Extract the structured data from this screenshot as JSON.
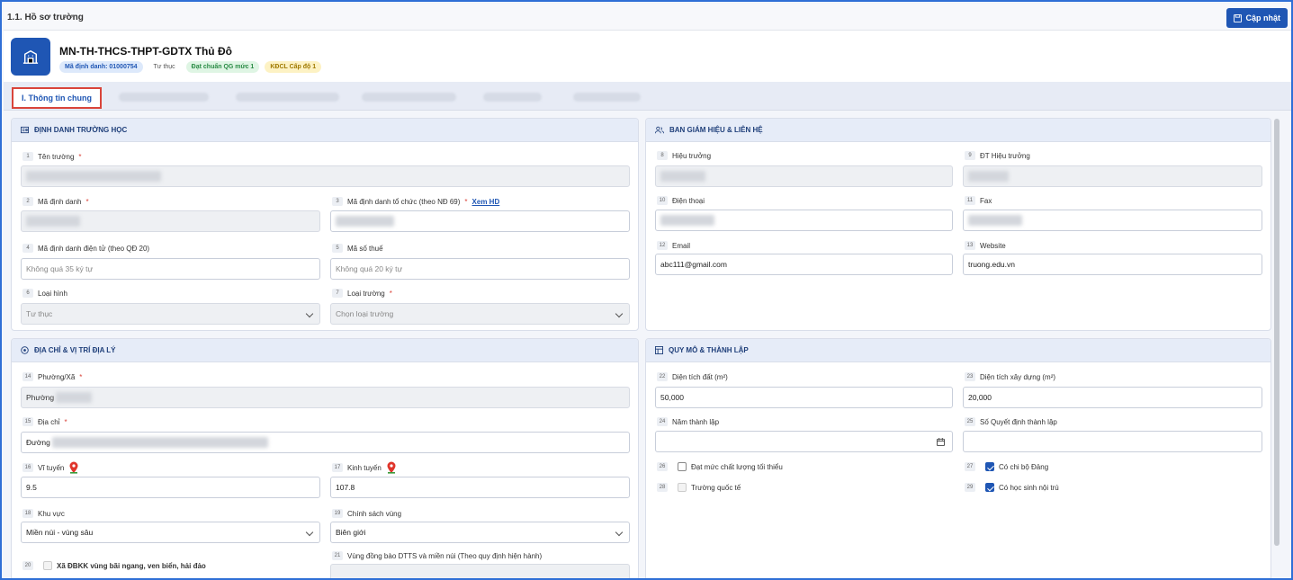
{
  "breadcrumb": "1.1. Hồ sơ trường",
  "update_button": "Cập nhật",
  "school": {
    "name": "MN-TH-THCS-THPT-GDTX Thủ Đô",
    "badges": [
      "Mã định danh: 01000754",
      "Tư thục",
      "Đạt chuẩn QG mức 1",
      "KĐCL Cấp độ 1"
    ]
  },
  "tabs": {
    "active": "I. Thông tin chung"
  },
  "identity": {
    "title": "ĐỊNH DANH TRƯỜNG HỌC",
    "f1": {
      "num": "1",
      "label": "Tên trường"
    },
    "f2": {
      "num": "2",
      "label": "Mã định danh"
    },
    "f3": {
      "num": "3",
      "label": "Mã định danh tổ chức (theo NĐ 69)",
      "link": "Xem HD"
    },
    "f4": {
      "num": "4",
      "label": "Mã định danh điện tử (theo QĐ 20)",
      "placeholder": "Không quá 35 ký tự"
    },
    "f5": {
      "num": "5",
      "label": "Mã số thuế",
      "placeholder": "Không quá 20 ký tự"
    },
    "f6": {
      "num": "6",
      "label": "Loại hình",
      "value": "Tư thục"
    },
    "f7": {
      "num": "7",
      "label": "Loại trường",
      "placeholder": "Chọn loại trường"
    }
  },
  "board": {
    "title": "BAN GIÁM HIỆU & LIÊN HỆ",
    "f8": {
      "num": "8",
      "label": "Hiệu trưởng"
    },
    "f9": {
      "num": "9",
      "label": "ĐT Hiệu trưởng"
    },
    "f10": {
      "num": "10",
      "label": "Điện thoại"
    },
    "f11": {
      "num": "11",
      "label": "Fax"
    },
    "f12": {
      "num": "12",
      "label": "Email",
      "value": "abc111@gmail.com"
    },
    "f13": {
      "num": "13",
      "label": "Website",
      "value": "truong.edu.vn"
    }
  },
  "address": {
    "title": "ĐỊA CHỈ & VỊ TRÍ ĐỊA LÝ",
    "f14": {
      "num": "14",
      "label": "Phường/Xã",
      "value": "Phường"
    },
    "f15": {
      "num": "15",
      "label": "Địa chỉ",
      "value": "Đường"
    },
    "f16": {
      "num": "16",
      "label": "Vĩ tuyến",
      "value": "9.5"
    },
    "f17": {
      "num": "17",
      "label": "Kinh tuyến",
      "value": "107.8"
    },
    "f18": {
      "num": "18",
      "label": "Khu vực",
      "value": "Miền núi - vùng sâu"
    },
    "f19": {
      "num": "19",
      "label": "Chính sách vùng",
      "value": "Biên giới"
    },
    "f20": {
      "num": "20",
      "label": "Xã ĐBKK vùng bãi ngang, ven biển, hải đảo"
    },
    "f21": {
      "num": "21",
      "label": "Vùng đồng bào DTTS và miền núi (Theo quy định hiện hành)"
    }
  },
  "scale": {
    "title": "QUY MÔ & THÀNH LẬP",
    "f22": {
      "num": "22",
      "label": "Diện tích đất (m²)",
      "value": "50,000"
    },
    "f23": {
      "num": "23",
      "label": "Diện tích xây dựng (m²)",
      "value": "20,000"
    },
    "f24": {
      "num": "24",
      "label": "Năm thành lập"
    },
    "f25": {
      "num": "25",
      "label": "Số Quyết định thành lập"
    },
    "f26": {
      "num": "26",
      "label": "Đạt mức chất lượng tối thiểu"
    },
    "f27": {
      "num": "27",
      "label": "Có chi bộ Đảng"
    },
    "f28": {
      "num": "28",
      "label": "Trường quốc tế"
    },
    "f29": {
      "num": "29",
      "label": "Có học sinh nội trú"
    }
  },
  "colors": {
    "primary": "#1f56b4",
    "required": "#d9443a"
  }
}
